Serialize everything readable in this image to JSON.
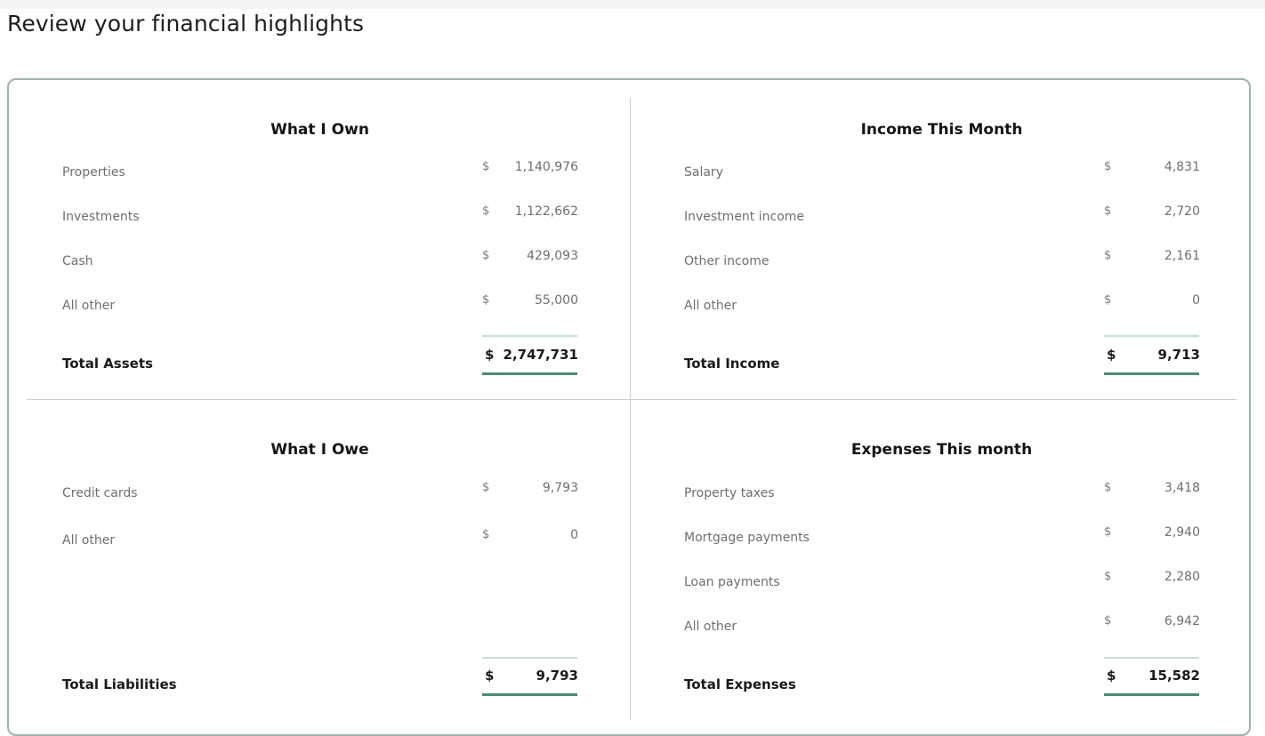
{
  "page": {
    "title": "Review your financial highlights"
  },
  "what_i_own": {
    "title": "What I Own",
    "items": [
      {
        "label": "Properties",
        "currency": "$",
        "value": "1,140,976"
      },
      {
        "label": "Investments",
        "currency": "$",
        "value": "1,122,662"
      },
      {
        "label": "Cash",
        "currency": "$",
        "value": "429,093"
      },
      {
        "label": "All other",
        "currency": "$",
        "value": "55,000"
      }
    ],
    "total": {
      "label": "Total Assets",
      "currency": "$",
      "value": "2,747,731"
    }
  },
  "income_this_month": {
    "title": "Income This Month",
    "items": [
      {
        "label": "Salary",
        "currency": "$",
        "value": "4,831"
      },
      {
        "label": "Investment income",
        "currency": "$",
        "value": "2,720"
      },
      {
        "label": "Other income",
        "currency": "$",
        "value": "2,161"
      },
      {
        "label": "All other",
        "currency": "$",
        "value": "0"
      }
    ],
    "total": {
      "label": "Total Income",
      "currency": "$",
      "value": "9,713"
    }
  },
  "what_i_owe": {
    "title": "What I Owe",
    "items": [
      {
        "label": "Credit cards",
        "currency": "$",
        "value": "9,793"
      },
      {
        "label": "All other",
        "currency": "$",
        "value": "0"
      }
    ],
    "total": {
      "label": "Total Liabilities",
      "currency": "$",
      "value": "9,793"
    }
  },
  "expenses_this_month": {
    "title": "Expenses This month",
    "items": [
      {
        "label": "Property taxes",
        "currency": "$",
        "value": "3,418"
      },
      {
        "label": "Mortgage payments",
        "currency": "$",
        "value": "2,940"
      },
      {
        "label": "Loan payments",
        "currency": "$",
        "value": "2,280"
      },
      {
        "label": "All other",
        "currency": "$",
        "value": "6,942"
      }
    ],
    "total": {
      "label": "Total Expenses",
      "currency": "$",
      "value": "15,582"
    }
  },
  "colors": {
    "card_border": "#9fb3ac",
    "total_underline": "#4d8b76",
    "total_overline": "#c5dcd4",
    "divider": "#c7d1cd"
  }
}
